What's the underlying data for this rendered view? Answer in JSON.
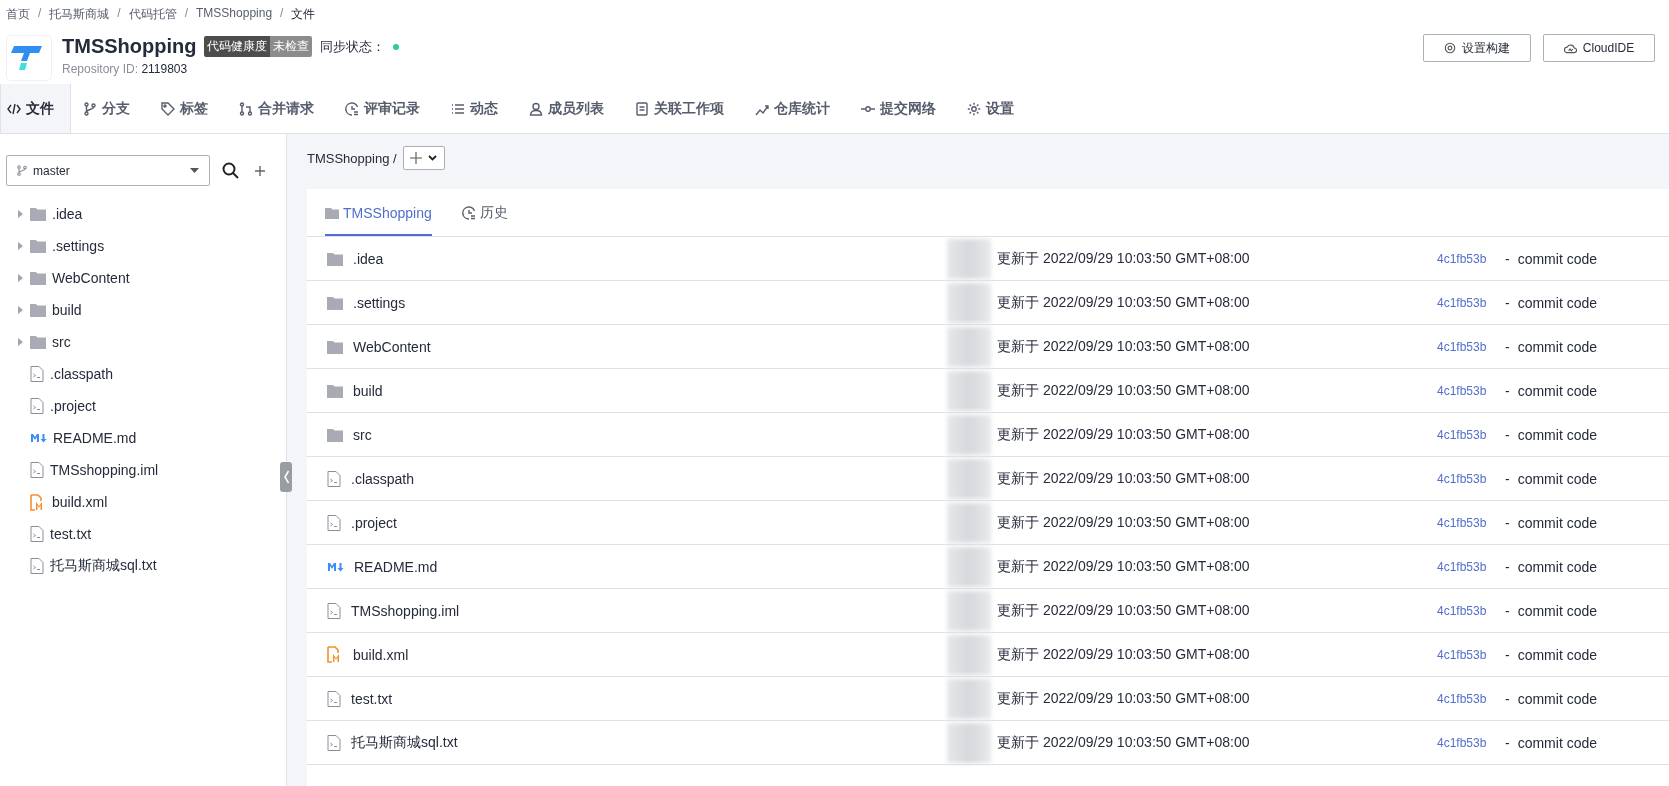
{
  "breadcrumb": [
    "首页",
    "/",
    "托马斯商城",
    "/",
    "代码托管",
    "/",
    "TMSShopping",
    "/",
    "文件"
  ],
  "repo": {
    "name": "TMSShopping",
    "health_label": "代码健康度",
    "health_value": "未检查",
    "sync_label": "同步状态：",
    "id_label": "Repository ID:",
    "id": "2119803"
  },
  "actions": [
    {
      "kind": "gear",
      "label": "设置构建"
    },
    {
      "kind": "cloud",
      "label": "CloudIDE"
    }
  ],
  "nav_tabs": [
    {
      "label": "文件",
      "selected": true
    },
    {
      "label": "分支",
      "selected": false
    },
    {
      "label": "标签",
      "selected": false
    },
    {
      "label": "合并请求",
      "selected": false
    },
    {
      "label": "评审记录",
      "selected": false
    },
    {
      "label": "动态",
      "selected": false
    },
    {
      "label": "成员列表",
      "selected": false
    },
    {
      "label": "关联工作项",
      "selected": false
    },
    {
      "label": "仓库统计",
      "selected": false
    },
    {
      "label": "提交网络",
      "selected": false
    },
    {
      "label": "设置",
      "selected": false
    }
  ],
  "branch": "master",
  "tree": [
    {
      "kind": "folder",
      "name": ".idea"
    },
    {
      "kind": "folder",
      "name": ".settings"
    },
    {
      "kind": "folder",
      "name": "WebContent"
    },
    {
      "kind": "folder",
      "name": "build"
    },
    {
      "kind": "folder",
      "name": "src"
    },
    {
      "kind": "file",
      "name": ".classpath"
    },
    {
      "kind": "file",
      "name": ".project"
    },
    {
      "kind": "markdown",
      "name": "README.md"
    },
    {
      "kind": "file",
      "name": "TMSshopping.iml"
    },
    {
      "kind": "xml",
      "name": "build.xml"
    },
    {
      "kind": "file",
      "name": "test.txt"
    },
    {
      "kind": "file",
      "name": "托马斯商城sql.txt"
    }
  ],
  "path": "TMSShopping /",
  "content_tabs": [
    {
      "label": "TMSShopping",
      "selected": true
    },
    {
      "label": "历史",
      "selected": false
    }
  ],
  "rows": [
    {
      "kind": "folder",
      "name": ".idea",
      "updated": "更新于 2022/09/29 10:03:50 GMT+08:00",
      "commit": "4c1fb53b",
      "sep": "-",
      "message": "commit code"
    },
    {
      "kind": "folder",
      "name": ".settings",
      "updated": "更新于 2022/09/29 10:03:50 GMT+08:00",
      "commit": "4c1fb53b",
      "sep": "-",
      "message": "commit code"
    },
    {
      "kind": "folder",
      "name": "WebContent",
      "updated": "更新于 2022/09/29 10:03:50 GMT+08:00",
      "commit": "4c1fb53b",
      "sep": "-",
      "message": "commit code"
    },
    {
      "kind": "folder",
      "name": "build",
      "updated": "更新于 2022/09/29 10:03:50 GMT+08:00",
      "commit": "4c1fb53b",
      "sep": "-",
      "message": "commit code"
    },
    {
      "kind": "folder",
      "name": "src",
      "updated": "更新于 2022/09/29 10:03:50 GMT+08:00",
      "commit": "4c1fb53b",
      "sep": "-",
      "message": "commit code"
    },
    {
      "kind": "file",
      "name": ".classpath",
      "updated": "更新于 2022/09/29 10:03:50 GMT+08:00",
      "commit": "4c1fb53b",
      "sep": "-",
      "message": "commit code"
    },
    {
      "kind": "file",
      "name": ".project",
      "updated": "更新于 2022/09/29 10:03:50 GMT+08:00",
      "commit": "4c1fb53b",
      "sep": "-",
      "message": "commit code"
    },
    {
      "kind": "markdown",
      "name": "README.md",
      "updated": "更新于 2022/09/29 10:03:50 GMT+08:00",
      "commit": "4c1fb53b",
      "sep": "-",
      "message": "commit code"
    },
    {
      "kind": "file",
      "name": "TMSshopping.iml",
      "updated": "更新于 2022/09/29 10:03:50 GMT+08:00",
      "commit": "4c1fb53b",
      "sep": "-",
      "message": "commit code"
    },
    {
      "kind": "xml",
      "name": "build.xml",
      "updated": "更新于 2022/09/29 10:03:50 GMT+08:00",
      "commit": "4c1fb53b",
      "sep": "-",
      "message": "commit code"
    },
    {
      "kind": "file",
      "name": "test.txt",
      "updated": "更新于 2022/09/29 10:03:50 GMT+08:00",
      "commit": "4c1fb53b",
      "sep": "-",
      "message": "commit code"
    },
    {
      "kind": "file",
      "name": "托马斯商城sql.txt",
      "updated": "更新于 2022/09/29 10:03:50 GMT+08:00",
      "commit": "4c1fb53b",
      "sep": "-",
      "message": "commit code"
    }
  ]
}
